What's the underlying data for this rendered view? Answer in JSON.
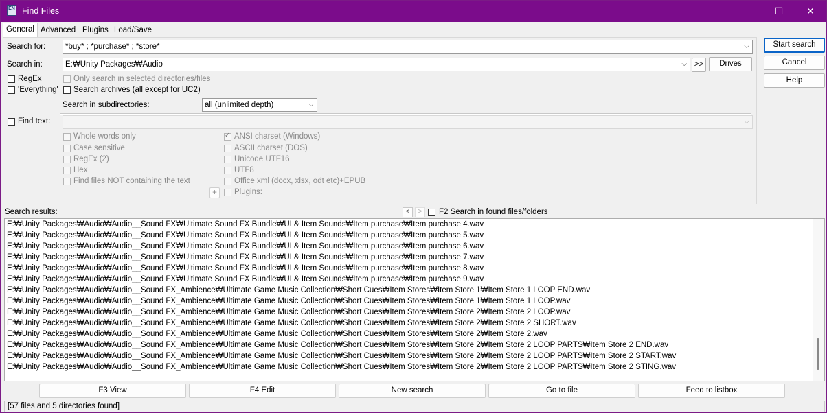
{
  "window": {
    "title": "Find Files",
    "icon_text": "EN",
    "minimize": "—",
    "maximize": "☐",
    "close": "✕"
  },
  "tabs": [
    "General",
    "Advanced",
    "Plugins",
    "Load/Save"
  ],
  "general": {
    "search_for_label": "Search for:",
    "search_for_value": "*buy* ; *purchase* ; *store*",
    "search_in_label": "Search in:",
    "search_in_value": "E:₩Unity Packages₩Audio",
    "browse_label": ">>",
    "drives_label": "Drives",
    "regex_label": "RegEx",
    "everything_label": "'Everything'",
    "only_selected_label": "Only search in selected directories/files",
    "search_archives_label": "Search archives (all except for UC2)",
    "subdirs_label": "Search in subdirectories:",
    "subdirs_value": "all (unlimited depth)",
    "find_text_label": "Find text:",
    "left_options": [
      "Whole words only",
      "Case sensitive",
      "RegEx (2)",
      "Hex",
      "Find files NOT containing the text"
    ],
    "right_options": [
      "ANSI charset (Windows)",
      "ASCII charset (DOS)",
      "Unicode UTF16",
      "UTF8",
      "Office xml (docx, xlsx, odt etc)+EPUB",
      "Plugins:"
    ],
    "plus_label": "+"
  },
  "side_buttons": {
    "start": "Start search",
    "cancel": "Cancel",
    "help": "Help"
  },
  "results": {
    "label": "Search results:",
    "prev": "<",
    "next": ">",
    "f2_label": "F2 Search in found files/folders",
    "rows": [
      "E:₩Unity Packages₩Audio₩Audio__Sound FX₩Ultimate Sound FX Bundle₩UI & Item Sounds₩Item purchase₩Item purchase 4.wav",
      "E:₩Unity Packages₩Audio₩Audio__Sound FX₩Ultimate Sound FX Bundle₩UI & Item Sounds₩Item purchase₩Item purchase 5.wav",
      "E:₩Unity Packages₩Audio₩Audio__Sound FX₩Ultimate Sound FX Bundle₩UI & Item Sounds₩Item purchase₩Item purchase 6.wav",
      "E:₩Unity Packages₩Audio₩Audio__Sound FX₩Ultimate Sound FX Bundle₩UI & Item Sounds₩Item purchase₩Item purchase 7.wav",
      "E:₩Unity Packages₩Audio₩Audio__Sound FX₩Ultimate Sound FX Bundle₩UI & Item Sounds₩Item purchase₩Item purchase 8.wav",
      "E:₩Unity Packages₩Audio₩Audio__Sound FX₩Ultimate Sound FX Bundle₩UI & Item Sounds₩Item purchase₩Item purchase 9.wav",
      "E:₩Unity Packages₩Audio₩Audio__Sound FX_Ambience₩Ultimate Game Music Collection₩Short Cues₩Item Stores₩Item Store 1₩Item Store 1 LOOP END.wav",
      "E:₩Unity Packages₩Audio₩Audio__Sound FX_Ambience₩Ultimate Game Music Collection₩Short Cues₩Item Stores₩Item Store 1₩Item Store 1 LOOP.wav",
      "E:₩Unity Packages₩Audio₩Audio__Sound FX_Ambience₩Ultimate Game Music Collection₩Short Cues₩Item Stores₩Item Store 2₩Item Store 2 LOOP.wav",
      "E:₩Unity Packages₩Audio₩Audio__Sound FX_Ambience₩Ultimate Game Music Collection₩Short Cues₩Item Stores₩Item Store 2₩Item Store 2 SHORT.wav",
      "E:₩Unity Packages₩Audio₩Audio__Sound FX_Ambience₩Ultimate Game Music Collection₩Short Cues₩Item Stores₩Item Store 2₩Item Store 2.wav",
      "E:₩Unity Packages₩Audio₩Audio__Sound FX_Ambience₩Ultimate Game Music Collection₩Short Cues₩Item Stores₩Item Store 2₩Item Store 2 LOOP PARTS₩Item Store 2 END.wav",
      "E:₩Unity Packages₩Audio₩Audio__Sound FX_Ambience₩Ultimate Game Music Collection₩Short Cues₩Item Stores₩Item Store 2₩Item Store 2 LOOP PARTS₩Item Store 2 START.wav",
      "E:₩Unity Packages₩Audio₩Audio__Sound FX_Ambience₩Ultimate Game Music Collection₩Short Cues₩Item Stores₩Item Store 2₩Item Store 2 LOOP PARTS₩Item Store 2 STING.wav"
    ]
  },
  "bottom_buttons": [
    "F3 View",
    "F4 Edit",
    "New search",
    "Go to file",
    "Feed to listbox"
  ],
  "status": "[57 files and 5 directories found]",
  "colors": {
    "titlebar": "#7b0c8b",
    "default_button_border": "#0a64c8"
  }
}
